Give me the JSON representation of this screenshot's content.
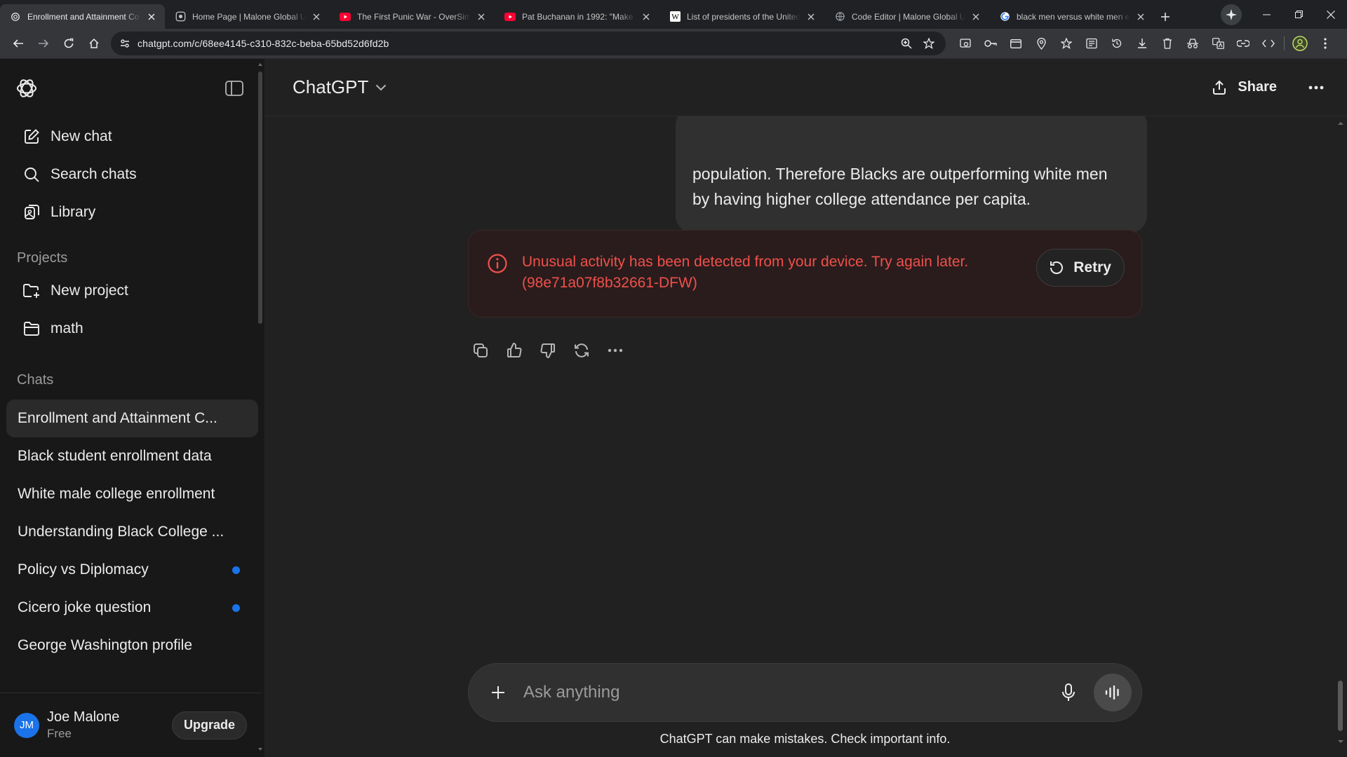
{
  "browser": {
    "tabs": [
      {
        "title": "Enrollment and Attainment Co",
        "icon": "openai-favicon",
        "active": true
      },
      {
        "title": "Home Page | Malone Global U",
        "icon": "globe-favicon"
      },
      {
        "title": "The First Punic War - OverSimp",
        "icon": "youtube-favicon"
      },
      {
        "title": "Pat Buchanan in 1992: \"Make A",
        "icon": "youtube-favicon"
      },
      {
        "title": "List of presidents of the United",
        "icon": "wikipedia-favicon"
      },
      {
        "title": "Code Editor | Malone Global U",
        "icon": "globe-favicon"
      },
      {
        "title": "black men versus white men e",
        "icon": "google-favicon"
      }
    ],
    "url": "chatgpt.com/c/68ee4145-c310-832c-beba-65bd52d6fd2b"
  },
  "sidebar": {
    "top_items": [
      {
        "label": "New chat",
        "icon": "compose-icon"
      },
      {
        "label": "Search chats",
        "icon": "search-icon"
      },
      {
        "label": "Library",
        "icon": "library-icon"
      }
    ],
    "projects_heading": "Projects",
    "projects": [
      {
        "label": "New project",
        "icon": "folder-plus-icon"
      },
      {
        "label": "math",
        "icon": "folder-icon"
      }
    ],
    "chats_heading": "Chats",
    "chats": [
      {
        "label": "Enrollment and Attainment C...",
        "active": true,
        "unread": false
      },
      {
        "label": "Black student enrollment data",
        "unread": false
      },
      {
        "label": "White male college enrollment",
        "unread": false
      },
      {
        "label": "Understanding Black College ...",
        "unread": false
      },
      {
        "label": "Policy vs Diplomacy",
        "unread": true
      },
      {
        "label": "Cicero joke question",
        "unread": true
      },
      {
        "label": "George Washington profile",
        "unread": false
      }
    ],
    "user": {
      "initials": "JM",
      "name": "Joe Malone",
      "plan": "Free",
      "upgrade_label": "Upgrade"
    }
  },
  "header": {
    "model": "ChatGPT",
    "share_label": "Share"
  },
  "conversation": {
    "user_message_lines": [
      "population. Therefore Blacks are outperforming white men",
      "by having higher college attendance per capita."
    ],
    "error": {
      "line1": "Unusual activity has been detected from your device. Try again later.",
      "line2": "(98e71a07f8b32661-DFW)",
      "retry_label": "Retry"
    }
  },
  "composer": {
    "placeholder": "Ask anything"
  },
  "disclaimer": "ChatGPT can make mistakes. Check important info.",
  "colors": {
    "accent": "#1a73e8",
    "error": "#f0504b",
    "background": "#212121",
    "sidebar": "#181818"
  }
}
